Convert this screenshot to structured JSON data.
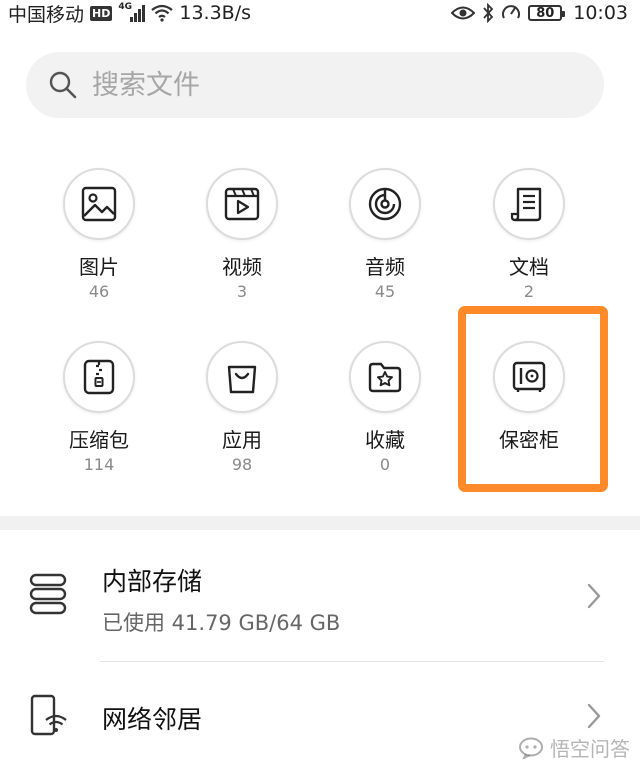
{
  "status_bar": {
    "carrier": "中国移动",
    "hd": "HD",
    "network": "4G",
    "speed": "13.3B/s",
    "battery": "80",
    "time": "10:03",
    "icons": [
      "hd-icon",
      "signal-icon",
      "wifi-icon",
      "eye-icon",
      "bluetooth-icon",
      "data-saver-icon",
      "battery-icon"
    ]
  },
  "search": {
    "placeholder": "搜索文件",
    "icon": "search-icon"
  },
  "categories": [
    {
      "label": "图片",
      "count": "46",
      "icon": "image-icon"
    },
    {
      "label": "视频",
      "count": "3",
      "icon": "video-icon"
    },
    {
      "label": "音频",
      "count": "45",
      "icon": "audio-icon"
    },
    {
      "label": "文档",
      "count": "2",
      "icon": "document-icon"
    },
    {
      "label": "压缩包",
      "count": "114",
      "icon": "archive-icon"
    },
    {
      "label": "应用",
      "count": "98",
      "icon": "app-icon"
    },
    {
      "label": "收藏",
      "count": "0",
      "icon": "favorites-icon"
    },
    {
      "label": "保密柜",
      "count": "",
      "icon": "safe-icon"
    }
  ],
  "highlight": {
    "color": "#ff8a2a",
    "target": "保密柜"
  },
  "storage": {
    "internal": {
      "title": "内部存储",
      "usage": "已使用 41.79 GB/64 GB",
      "icon": "storage-icon"
    },
    "network": {
      "title": "网络邻居",
      "icon": "network-neighbor-icon"
    }
  },
  "watermark": {
    "text": "悟空问答"
  },
  "colors": {
    "accent": "#ff8a2a",
    "text": "#1a1a1a",
    "subtext": "#8a8a8a",
    "search_bg": "#f2f2f2"
  }
}
